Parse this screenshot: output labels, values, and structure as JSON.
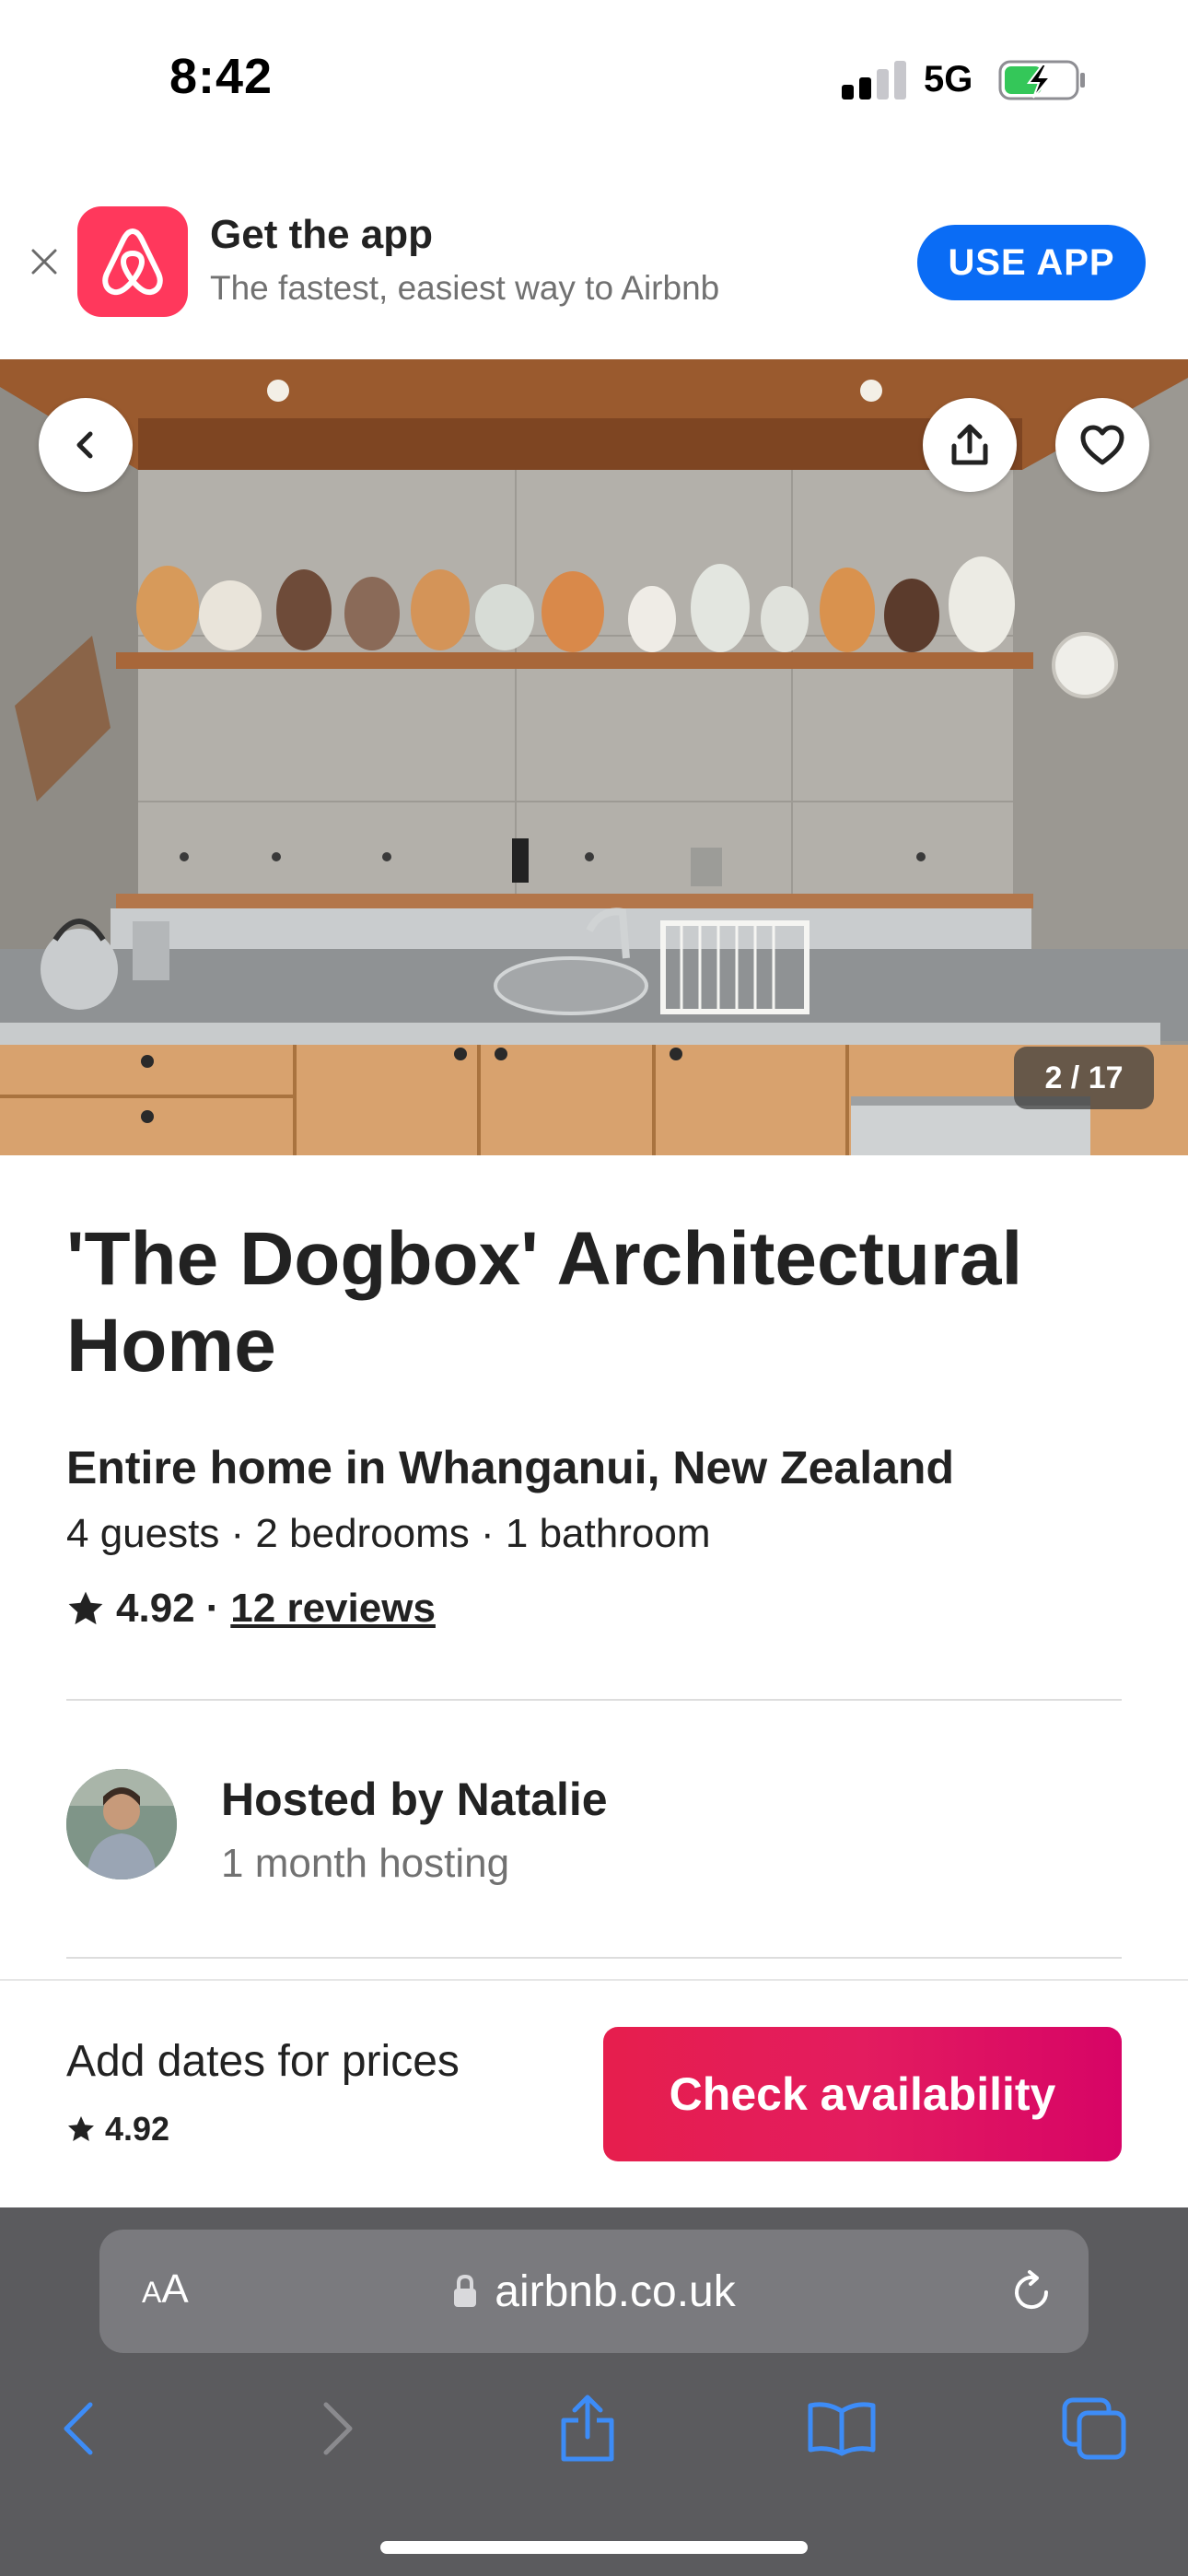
{
  "status_bar": {
    "time": "8:42",
    "network": "5G"
  },
  "app_banner": {
    "title": "Get the app",
    "subtitle": "The fastest, easiest way to Airbnb",
    "button_label": "USE APP"
  },
  "photo": {
    "counter": "2 / 17"
  },
  "listing": {
    "title": "'The Dogbox' Architectural Home",
    "subtitle": "Entire home in Whanganui, New Zealand",
    "details": "4 guests · 2 bedrooms · 1 bathroom",
    "rating": "4.92",
    "separator": "·",
    "reviews": "12 reviews"
  },
  "host": {
    "name": "Hosted by Natalie",
    "since": "1 month hosting"
  },
  "booking_bar": {
    "price_label": "Add dates for prices",
    "rating": "4.92",
    "button_label": "Check availability"
  },
  "browser": {
    "text_size_small": "A",
    "text_size_big": "A",
    "url": "airbnb.co.uk"
  },
  "colors": {
    "brand": "#ff385c",
    "use_app_blue": "#0a6cf5",
    "safari_accent": "#3d8cf7"
  }
}
